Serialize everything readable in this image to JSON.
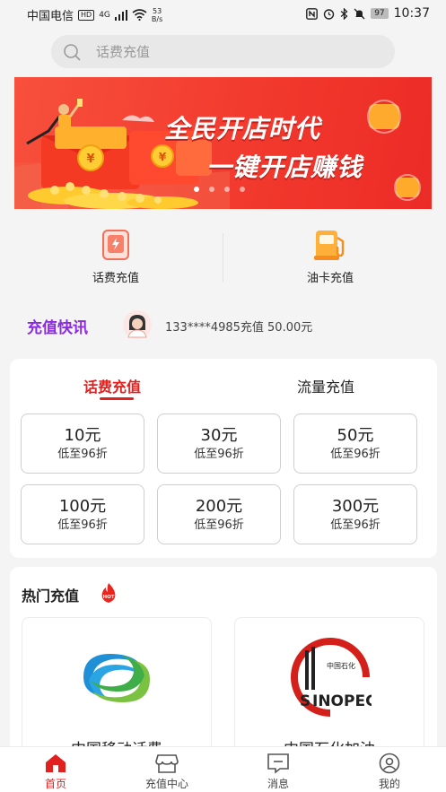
{
  "status_bar": {
    "carrier": "中国电信",
    "hd": "HD",
    "signal": "4G",
    "speed_value": "53",
    "speed_unit": "B/s",
    "battery": "97",
    "time": "10:37"
  },
  "search": {
    "placeholder": "话费充值"
  },
  "banner": {
    "line1": "全民开店时代",
    "line2": "一键开店赚钱",
    "slide_count": 4,
    "active_slide": 1
  },
  "quick_entries": [
    {
      "label": "话费充值",
      "icon": "phone-recharge-icon"
    },
    {
      "label": "油卡充值",
      "icon": "fuel-pump-icon"
    }
  ],
  "flash_news": {
    "title": "充值快讯",
    "text": "133****4985充值 50.00元"
  },
  "recharge": {
    "tabs": [
      {
        "label": "话费充值",
        "active": true
      },
      {
        "label": "流量充值",
        "active": false
      }
    ],
    "options": [
      {
        "amount": "10元",
        "discount": "低至96折"
      },
      {
        "amount": "30元",
        "discount": "低至96折"
      },
      {
        "amount": "50元",
        "discount": "低至96折"
      },
      {
        "amount": "100元",
        "discount": "低至96折"
      },
      {
        "amount": "200元",
        "discount": "低至96折"
      },
      {
        "amount": "300元",
        "discount": "低至96折"
      }
    ]
  },
  "hot": {
    "title": "热门充值",
    "badge": "HOT",
    "items": [
      {
        "name": "中国移动话费",
        "logo": "china-mobile-logo"
      },
      {
        "name": "中国石化加油",
        "logo": "sinopec-logo",
        "logo_text": "中国石化"
      }
    ]
  },
  "tabbar": [
    {
      "label": "首页",
      "icon": "home-icon",
      "active": true
    },
    {
      "label": "充值中心",
      "icon": "store-icon",
      "active": false
    },
    {
      "label": "消息",
      "icon": "message-icon",
      "active": false
    },
    {
      "label": "我的",
      "icon": "profile-icon",
      "active": false
    }
  ],
  "colors": {
    "accent": "#e0211f",
    "flash_title": "#8a2be2",
    "banner": "#f23a2e",
    "background": "#f4f4f4"
  }
}
